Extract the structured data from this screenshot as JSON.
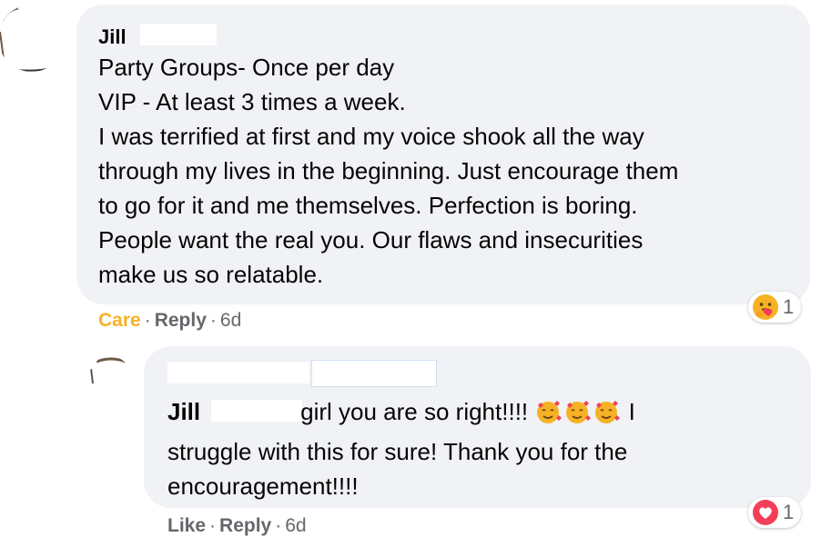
{
  "comment": {
    "author": "Jill",
    "lines": [
      "Party Groups- Once per day",
      "VIP - At least 3 times a week.",
      "I was terrified at first and my voice shook all the way",
      "through my lives in the beginning. Just encourage them",
      "to go for it and me themselves. Perfection is boring.",
      "People want the real you. Our flaws and insecurities",
      "make us so relatable."
    ],
    "actions": {
      "reaction_label": "Care",
      "reply_label": "Reply",
      "time": "6d"
    },
    "reaction": {
      "icon": "care-emoji-icon",
      "count": "1"
    }
  },
  "reply": {
    "mention": "Jill",
    "line1_text": "girl you are so right!!!!",
    "line1_tail": "I",
    "line2": "struggle with this for sure! Thank you for the",
    "line3": "encouragement!!!!",
    "emojis": [
      "smiling-face-with-hearts-icon",
      "smiling-face-with-hearts-icon",
      "smiling-face-with-hearts-icon"
    ],
    "actions": {
      "like_label": "Like",
      "reply_label": "Reply",
      "time": "6d"
    },
    "reaction": {
      "icon": "love-heart-icon",
      "count": "1",
      "color": "#f33e58"
    }
  },
  "colors": {
    "bubble": "#f0f2f5",
    "meta": "#65676b",
    "care": "#f7b125"
  }
}
